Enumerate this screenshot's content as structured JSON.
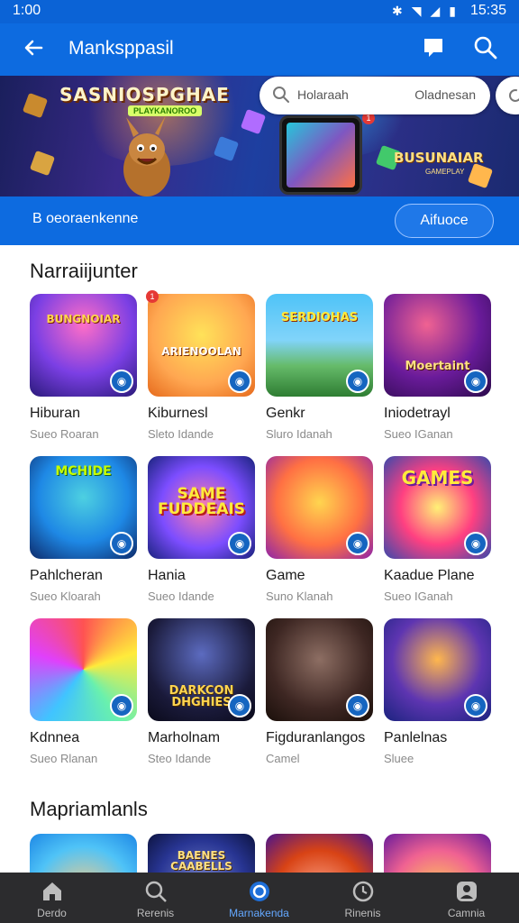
{
  "status_bar": {
    "time_left": "1:00",
    "time_right": "15:35"
  },
  "app_bar": {
    "title": "Manksppasil"
  },
  "banner": {
    "logo_text": "SASNIOSPGHAE",
    "logo_sub": "PLAYKANOROO",
    "search_placeholder": "Holaraah",
    "search_right": "Oladnesan",
    "notif_count": "1",
    "right_logo": "BUSUNAIAR",
    "right_sub": "GAMEPLAY"
  },
  "strip": {
    "left_text": "B oeoraenkenne",
    "button_label": "Aifuoce"
  },
  "sections": [
    {
      "title": "Narraiijunter",
      "tiles": [
        {
          "name": "Hiburan",
          "sub": "Sueo Roaran",
          "art_text": "BUNGNOIAR"
        },
        {
          "name": "Kiburnesl",
          "sub": "Sleto Idande",
          "art_text": "ARIENOOLAN"
        },
        {
          "name": "Genkr",
          "sub": "Sluro Idanah",
          "art_text": "SERDIOHAS"
        },
        {
          "name": "Iniodetrayl",
          "sub": "Sueo IGanan",
          "art_text": "Moertaint"
        },
        {
          "name": "Pahlcheran",
          "sub": "Sueo Kloarah",
          "art_text": "MCHIDE"
        },
        {
          "name": "Hania",
          "sub": "Sueo Idande",
          "art_text": "SAME FUDDEAIS"
        },
        {
          "name": "Game",
          "sub": "Suno Klanah",
          "art_text": ""
        },
        {
          "name": "Kaadue Plane",
          "sub": "Sueo IGanah",
          "art_text": "GAMES"
        },
        {
          "name": "Kdnnea",
          "sub": "Sueo Rlanan",
          "art_text": ""
        },
        {
          "name": "Marholnam",
          "sub": "Steo Idande",
          "art_text": "DARKCON DHGHIES"
        },
        {
          "name": "Figduranlangos",
          "sub": "Camel",
          "art_text": ""
        },
        {
          "name": "Panlelnas",
          "sub": "Sluee",
          "art_text": ""
        }
      ]
    },
    {
      "title": "Mapriamlanls",
      "tiles": [
        {
          "art_text": ""
        },
        {
          "art_text": "BAENES CAABELLS"
        },
        {
          "art_text": ""
        },
        {
          "art_text": ""
        }
      ]
    }
  ],
  "notif_badge": "1",
  "bottom_nav": [
    {
      "label": "Derdo",
      "icon": "home-icon",
      "active": false
    },
    {
      "label": "Rerenis",
      "icon": "search-icon",
      "active": false
    },
    {
      "label": "Marnakenda",
      "icon": "games-icon",
      "active": true
    },
    {
      "label": "Rinenis",
      "icon": "clock-icon",
      "active": false
    },
    {
      "label": "Camnia",
      "icon": "profile-icon",
      "active": false
    }
  ],
  "colors": {
    "primary": "#0d6be0",
    "nav_bg": "#2c2c2e",
    "accent_active": "#64a8ff",
    "badge": "#1565c0",
    "notif": "#e53935"
  }
}
